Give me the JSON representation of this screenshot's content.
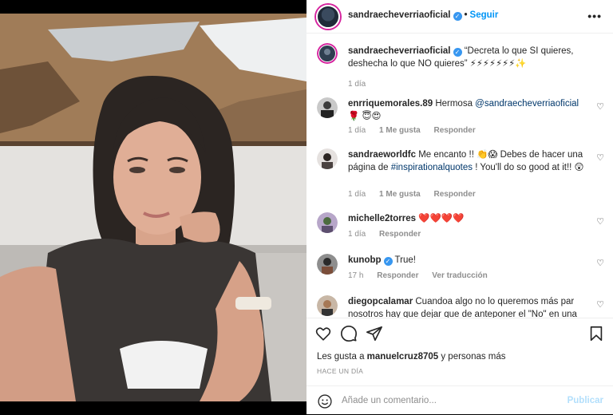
{
  "header": {
    "username": "sandraecheverriaoficial",
    "separator": "•",
    "follow_label": "Seguir",
    "more_label": "•••"
  },
  "caption": {
    "username": "sandraecheverriaoficial",
    "text": "“Decreta lo que SI quieres, deshecha lo que NO quieres” ⚡⚡⚡⚡⚡⚡⚡✨",
    "time": "1 día"
  },
  "comments": [
    {
      "username": "enrriquemorales.89",
      "text_before": "Hermosa ",
      "mention": "@sandraecheverriaoficial",
      "text_after": " 🌹 😇😍",
      "time": "1 día",
      "likes": "1 Me gusta",
      "reply": "Responder"
    },
    {
      "username": "sandraeworldfc",
      "text_before": "Me encanto !! 👏😱 Debes de hacer una página de ",
      "hashtag": "#inspirationalquotes",
      "text_after": " ! You'll do so good at it!! 😲",
      "time": "1 día",
      "likes": "1 Me gusta",
      "reply": "Responder"
    },
    {
      "username": "michelle2torres",
      "text": "❤️❤️❤️❤️",
      "time": "1 día",
      "reply": "Responder"
    },
    {
      "username": "kunobp",
      "text": "True!",
      "time": "17 h",
      "reply": "Responder",
      "translate": "Ver traducción"
    },
    {
      "username": "diegopcalamar",
      "text": "Cuandoa algo no lo queremos más par nosotros hay que dejar que de anteponer el \"No\" en una"
    }
  ],
  "actions": {
    "likes_prefix": "Les gusta a ",
    "likes_user": "manuelcruz8705",
    "likes_suffix": " y personas más",
    "posted_ago": "HACE UN DÍA"
  },
  "add_comment": {
    "placeholder": "Añade un comentario...",
    "publish_label": "Publicar"
  },
  "colors": {
    "accent": "#0095f6",
    "verified": "#3897f0",
    "muted": "#8e8e8e",
    "link": "#00376b"
  }
}
